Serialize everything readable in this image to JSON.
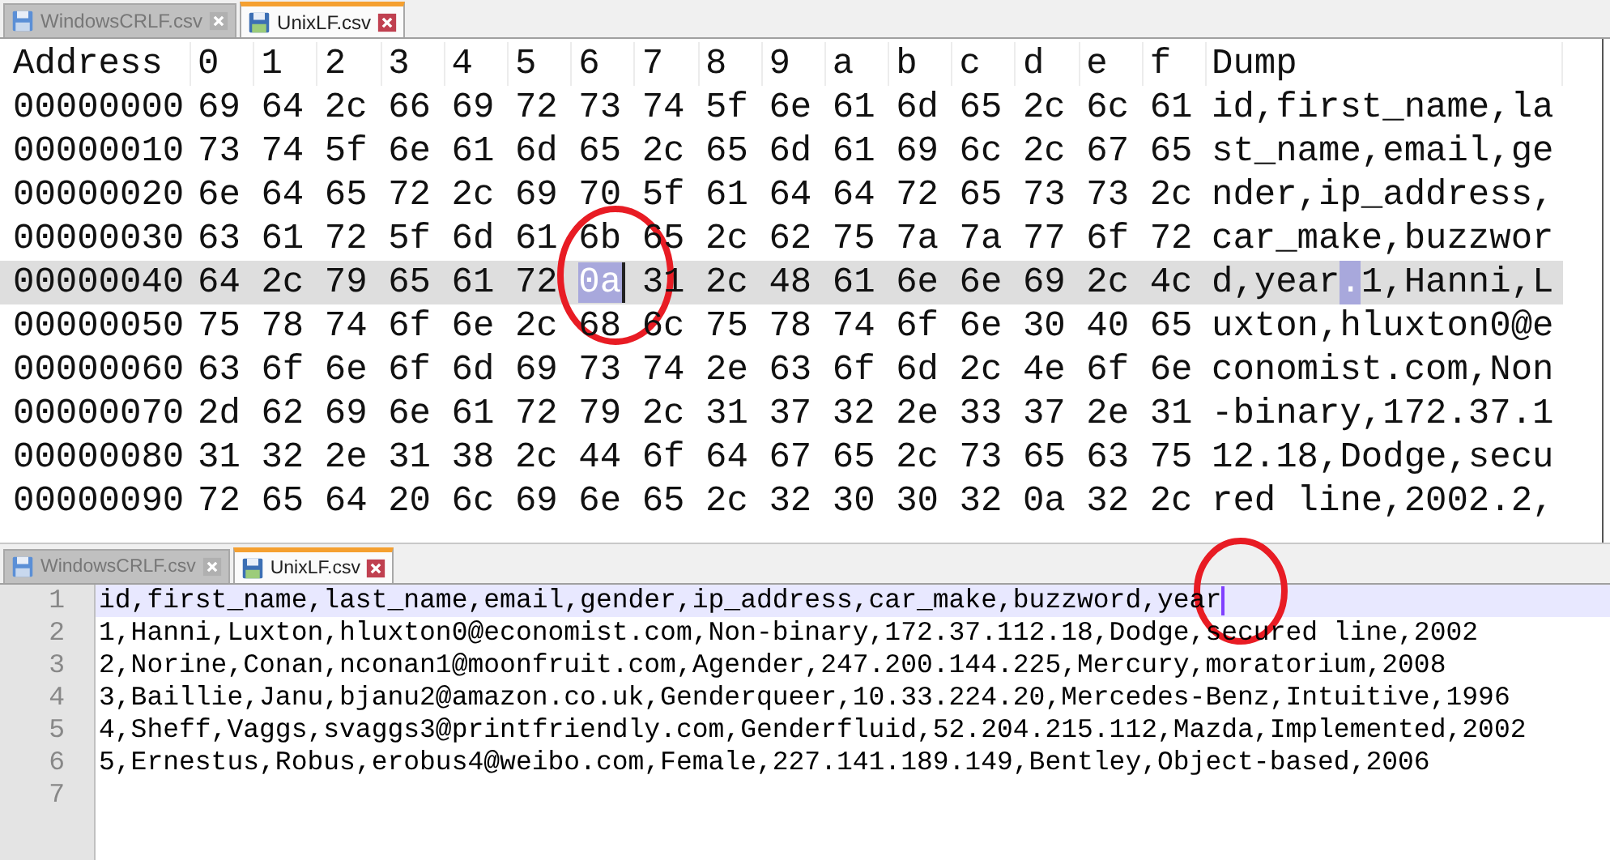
{
  "hex_pane": {
    "tabs": [
      {
        "label": "WindowsCRLF.csv",
        "selected": false
      },
      {
        "label": "UnixLF.csv",
        "selected": true
      }
    ],
    "columns": [
      "Address",
      "0",
      "1",
      "2",
      "3",
      "4",
      "5",
      "6",
      "7",
      "8",
      "9",
      "a",
      "b",
      "c",
      "d",
      "e",
      "f",
      "Dump"
    ],
    "rows": [
      {
        "address": "00000000",
        "current": false,
        "bytes": [
          {
            "hex": "69",
            "selected": false
          },
          {
            "hex": "64",
            "selected": false
          },
          {
            "hex": "2c",
            "selected": false
          },
          {
            "hex": "66",
            "selected": false
          },
          {
            "hex": "69",
            "selected": false
          },
          {
            "hex": "72",
            "selected": false
          },
          {
            "hex": "73",
            "selected": false
          },
          {
            "hex": "74",
            "selected": false
          },
          {
            "hex": "5f",
            "selected": false
          },
          {
            "hex": "6e",
            "selected": false
          },
          {
            "hex": "61",
            "selected": false
          },
          {
            "hex": "6d",
            "selected": false
          },
          {
            "hex": "65",
            "selected": false
          },
          {
            "hex": "2c",
            "selected": false
          },
          {
            "hex": "6c",
            "selected": false
          },
          {
            "hex": "61",
            "selected": false
          }
        ],
        "dump": [
          {
            "text": "id,first_name,la",
            "selected": false
          }
        ]
      },
      {
        "address": "00000010",
        "current": false,
        "bytes": [
          {
            "hex": "73",
            "selected": false
          },
          {
            "hex": "74",
            "selected": false
          },
          {
            "hex": "5f",
            "selected": false
          },
          {
            "hex": "6e",
            "selected": false
          },
          {
            "hex": "61",
            "selected": false
          },
          {
            "hex": "6d",
            "selected": false
          },
          {
            "hex": "65",
            "selected": false
          },
          {
            "hex": "2c",
            "selected": false
          },
          {
            "hex": "65",
            "selected": false
          },
          {
            "hex": "6d",
            "selected": false
          },
          {
            "hex": "61",
            "selected": false
          },
          {
            "hex": "69",
            "selected": false
          },
          {
            "hex": "6c",
            "selected": false
          },
          {
            "hex": "2c",
            "selected": false
          },
          {
            "hex": "67",
            "selected": false
          },
          {
            "hex": "65",
            "selected": false
          }
        ],
        "dump": [
          {
            "text": "st_name,email,ge",
            "selected": false
          }
        ]
      },
      {
        "address": "00000020",
        "current": false,
        "bytes": [
          {
            "hex": "6e",
            "selected": false
          },
          {
            "hex": "64",
            "selected": false
          },
          {
            "hex": "65",
            "selected": false
          },
          {
            "hex": "72",
            "selected": false
          },
          {
            "hex": "2c",
            "selected": false
          },
          {
            "hex": "69",
            "selected": false
          },
          {
            "hex": "70",
            "selected": false
          },
          {
            "hex": "5f",
            "selected": false
          },
          {
            "hex": "61",
            "selected": false
          },
          {
            "hex": "64",
            "selected": false
          },
          {
            "hex": "64",
            "selected": false
          },
          {
            "hex": "72",
            "selected": false
          },
          {
            "hex": "65",
            "selected": false
          },
          {
            "hex": "73",
            "selected": false
          },
          {
            "hex": "73",
            "selected": false
          },
          {
            "hex": "2c",
            "selected": false
          }
        ],
        "dump": [
          {
            "text": "nder,ip_address,",
            "selected": false
          }
        ]
      },
      {
        "address": "00000030",
        "current": false,
        "bytes": [
          {
            "hex": "63",
            "selected": false
          },
          {
            "hex": "61",
            "selected": false
          },
          {
            "hex": "72",
            "selected": false
          },
          {
            "hex": "5f",
            "selected": false
          },
          {
            "hex": "6d",
            "selected": false
          },
          {
            "hex": "61",
            "selected": false
          },
          {
            "hex": "6b",
            "selected": false
          },
          {
            "hex": "65",
            "selected": false
          },
          {
            "hex": "2c",
            "selected": false
          },
          {
            "hex": "62",
            "selected": false
          },
          {
            "hex": "75",
            "selected": false
          },
          {
            "hex": "7a",
            "selected": false
          },
          {
            "hex": "7a",
            "selected": false
          },
          {
            "hex": "77",
            "selected": false
          },
          {
            "hex": "6f",
            "selected": false
          },
          {
            "hex": "72",
            "selected": false
          }
        ],
        "dump": [
          {
            "text": "car_make,buzzwor",
            "selected": false
          }
        ]
      },
      {
        "address": "00000040",
        "current": true,
        "bytes": [
          {
            "hex": "64",
            "selected": false
          },
          {
            "hex": "2c",
            "selected": false
          },
          {
            "hex": "79",
            "selected": false
          },
          {
            "hex": "65",
            "selected": false
          },
          {
            "hex": "61",
            "selected": false
          },
          {
            "hex": "72",
            "selected": false
          },
          {
            "hex": "0a",
            "selected": true
          },
          {
            "hex": "31",
            "selected": false
          },
          {
            "hex": "2c",
            "selected": false
          },
          {
            "hex": "48",
            "selected": false
          },
          {
            "hex": "61",
            "selected": false
          },
          {
            "hex": "6e",
            "selected": false
          },
          {
            "hex": "6e",
            "selected": false
          },
          {
            "hex": "69",
            "selected": false
          },
          {
            "hex": "2c",
            "selected": false
          },
          {
            "hex": "4c",
            "selected": false
          }
        ],
        "dump": [
          {
            "text": "d,year",
            "selected": false
          },
          {
            "text": ".",
            "selected": true
          },
          {
            "text": "1,Hanni,L",
            "selected": false
          }
        ]
      },
      {
        "address": "00000050",
        "current": false,
        "bytes": [
          {
            "hex": "75",
            "selected": false
          },
          {
            "hex": "78",
            "selected": false
          },
          {
            "hex": "74",
            "selected": false
          },
          {
            "hex": "6f",
            "selected": false
          },
          {
            "hex": "6e",
            "selected": false
          },
          {
            "hex": "2c",
            "selected": false
          },
          {
            "hex": "68",
            "selected": false
          },
          {
            "hex": "6c",
            "selected": false
          },
          {
            "hex": "75",
            "selected": false
          },
          {
            "hex": "78",
            "selected": false
          },
          {
            "hex": "74",
            "selected": false
          },
          {
            "hex": "6f",
            "selected": false
          },
          {
            "hex": "6e",
            "selected": false
          },
          {
            "hex": "30",
            "selected": false
          },
          {
            "hex": "40",
            "selected": false
          },
          {
            "hex": "65",
            "selected": false
          }
        ],
        "dump": [
          {
            "text": "uxton,hluxton0@e",
            "selected": false
          }
        ]
      },
      {
        "address": "00000060",
        "current": false,
        "bytes": [
          {
            "hex": "63",
            "selected": false
          },
          {
            "hex": "6f",
            "selected": false
          },
          {
            "hex": "6e",
            "selected": false
          },
          {
            "hex": "6f",
            "selected": false
          },
          {
            "hex": "6d",
            "selected": false
          },
          {
            "hex": "69",
            "selected": false
          },
          {
            "hex": "73",
            "selected": false
          },
          {
            "hex": "74",
            "selected": false
          },
          {
            "hex": "2e",
            "selected": false
          },
          {
            "hex": "63",
            "selected": false
          },
          {
            "hex": "6f",
            "selected": false
          },
          {
            "hex": "6d",
            "selected": false
          },
          {
            "hex": "2c",
            "selected": false
          },
          {
            "hex": "4e",
            "selected": false
          },
          {
            "hex": "6f",
            "selected": false
          },
          {
            "hex": "6e",
            "selected": false
          }
        ],
        "dump": [
          {
            "text": "conomist.com,Non",
            "selected": false
          }
        ]
      },
      {
        "address": "00000070",
        "current": false,
        "bytes": [
          {
            "hex": "2d",
            "selected": false
          },
          {
            "hex": "62",
            "selected": false
          },
          {
            "hex": "69",
            "selected": false
          },
          {
            "hex": "6e",
            "selected": false
          },
          {
            "hex": "61",
            "selected": false
          },
          {
            "hex": "72",
            "selected": false
          },
          {
            "hex": "79",
            "selected": false
          },
          {
            "hex": "2c",
            "selected": false
          },
          {
            "hex": "31",
            "selected": false
          },
          {
            "hex": "37",
            "selected": false
          },
          {
            "hex": "32",
            "selected": false
          },
          {
            "hex": "2e",
            "selected": false
          },
          {
            "hex": "33",
            "selected": false
          },
          {
            "hex": "37",
            "selected": false
          },
          {
            "hex": "2e",
            "selected": false
          },
          {
            "hex": "31",
            "selected": false
          }
        ],
        "dump": [
          {
            "text": "-binary,172.37.1",
            "selected": false
          }
        ]
      },
      {
        "address": "00000080",
        "current": false,
        "bytes": [
          {
            "hex": "31",
            "selected": false
          },
          {
            "hex": "32",
            "selected": false
          },
          {
            "hex": "2e",
            "selected": false
          },
          {
            "hex": "31",
            "selected": false
          },
          {
            "hex": "38",
            "selected": false
          },
          {
            "hex": "2c",
            "selected": false
          },
          {
            "hex": "44",
            "selected": false
          },
          {
            "hex": "6f",
            "selected": false
          },
          {
            "hex": "64",
            "selected": false
          },
          {
            "hex": "67",
            "selected": false
          },
          {
            "hex": "65",
            "selected": false
          },
          {
            "hex": "2c",
            "selected": false
          },
          {
            "hex": "73",
            "selected": false
          },
          {
            "hex": "65",
            "selected": false
          },
          {
            "hex": "63",
            "selected": false
          },
          {
            "hex": "75",
            "selected": false
          }
        ],
        "dump": [
          {
            "text": "12.18,Dodge,secu",
            "selected": false
          }
        ]
      },
      {
        "address": "00000090",
        "current": false,
        "bytes": [
          {
            "hex": "72",
            "selected": false
          },
          {
            "hex": "65",
            "selected": false
          },
          {
            "hex": "64",
            "selected": false
          },
          {
            "hex": "20",
            "selected": false
          },
          {
            "hex": "6c",
            "selected": false
          },
          {
            "hex": "69",
            "selected": false
          },
          {
            "hex": "6e",
            "selected": false
          },
          {
            "hex": "65",
            "selected": false
          },
          {
            "hex": "2c",
            "selected": false
          },
          {
            "hex": "32",
            "selected": false
          },
          {
            "hex": "30",
            "selected": false
          },
          {
            "hex": "30",
            "selected": false
          },
          {
            "hex": "32",
            "selected": false
          },
          {
            "hex": "0a",
            "selected": false
          },
          {
            "hex": "32",
            "selected": false
          },
          {
            "hex": "2c",
            "selected": false
          }
        ],
        "dump": [
          {
            "text": "red line,2002.2,",
            "selected": false
          }
        ]
      }
    ]
  },
  "text_pane": {
    "tabs": [
      {
        "label": "WindowsCRLF.csv",
        "selected": false
      },
      {
        "label": "UnixLF.csv",
        "selected": true
      }
    ],
    "lines": [
      {
        "number": "1",
        "current": true,
        "text": "id,first_name,last_name,email,gender,ip_address,car_make,buzzword,year"
      },
      {
        "number": "2",
        "current": false,
        "text": "1,Hanni,Luxton,hluxton0@economist.com,Non-binary,172.37.112.18,Dodge,secured line,2002"
      },
      {
        "number": "3",
        "current": false,
        "text": "2,Norine,Conan,nconan1@moonfruit.com,Agender,247.200.144.225,Mercury,moratorium,2008"
      },
      {
        "number": "4",
        "current": false,
        "text": "3,Baillie,Janu,bjanu2@amazon.co.uk,Genderqueer,10.33.224.20,Mercedes-Benz,Intuitive,1996"
      },
      {
        "number": "5",
        "current": false,
        "text": "4,Sheff,Vaggs,svaggs3@printfriendly.com,Genderfluid,52.204.215.112,Mazda,Implemented,2002"
      },
      {
        "number": "6",
        "current": false,
        "text": "5,Ernestus,Robus,erobus4@weibo.com,Female,227.141.189.149,Bentley,Object-based,2006"
      },
      {
        "number": "7",
        "current": false
      }
    ]
  }
}
